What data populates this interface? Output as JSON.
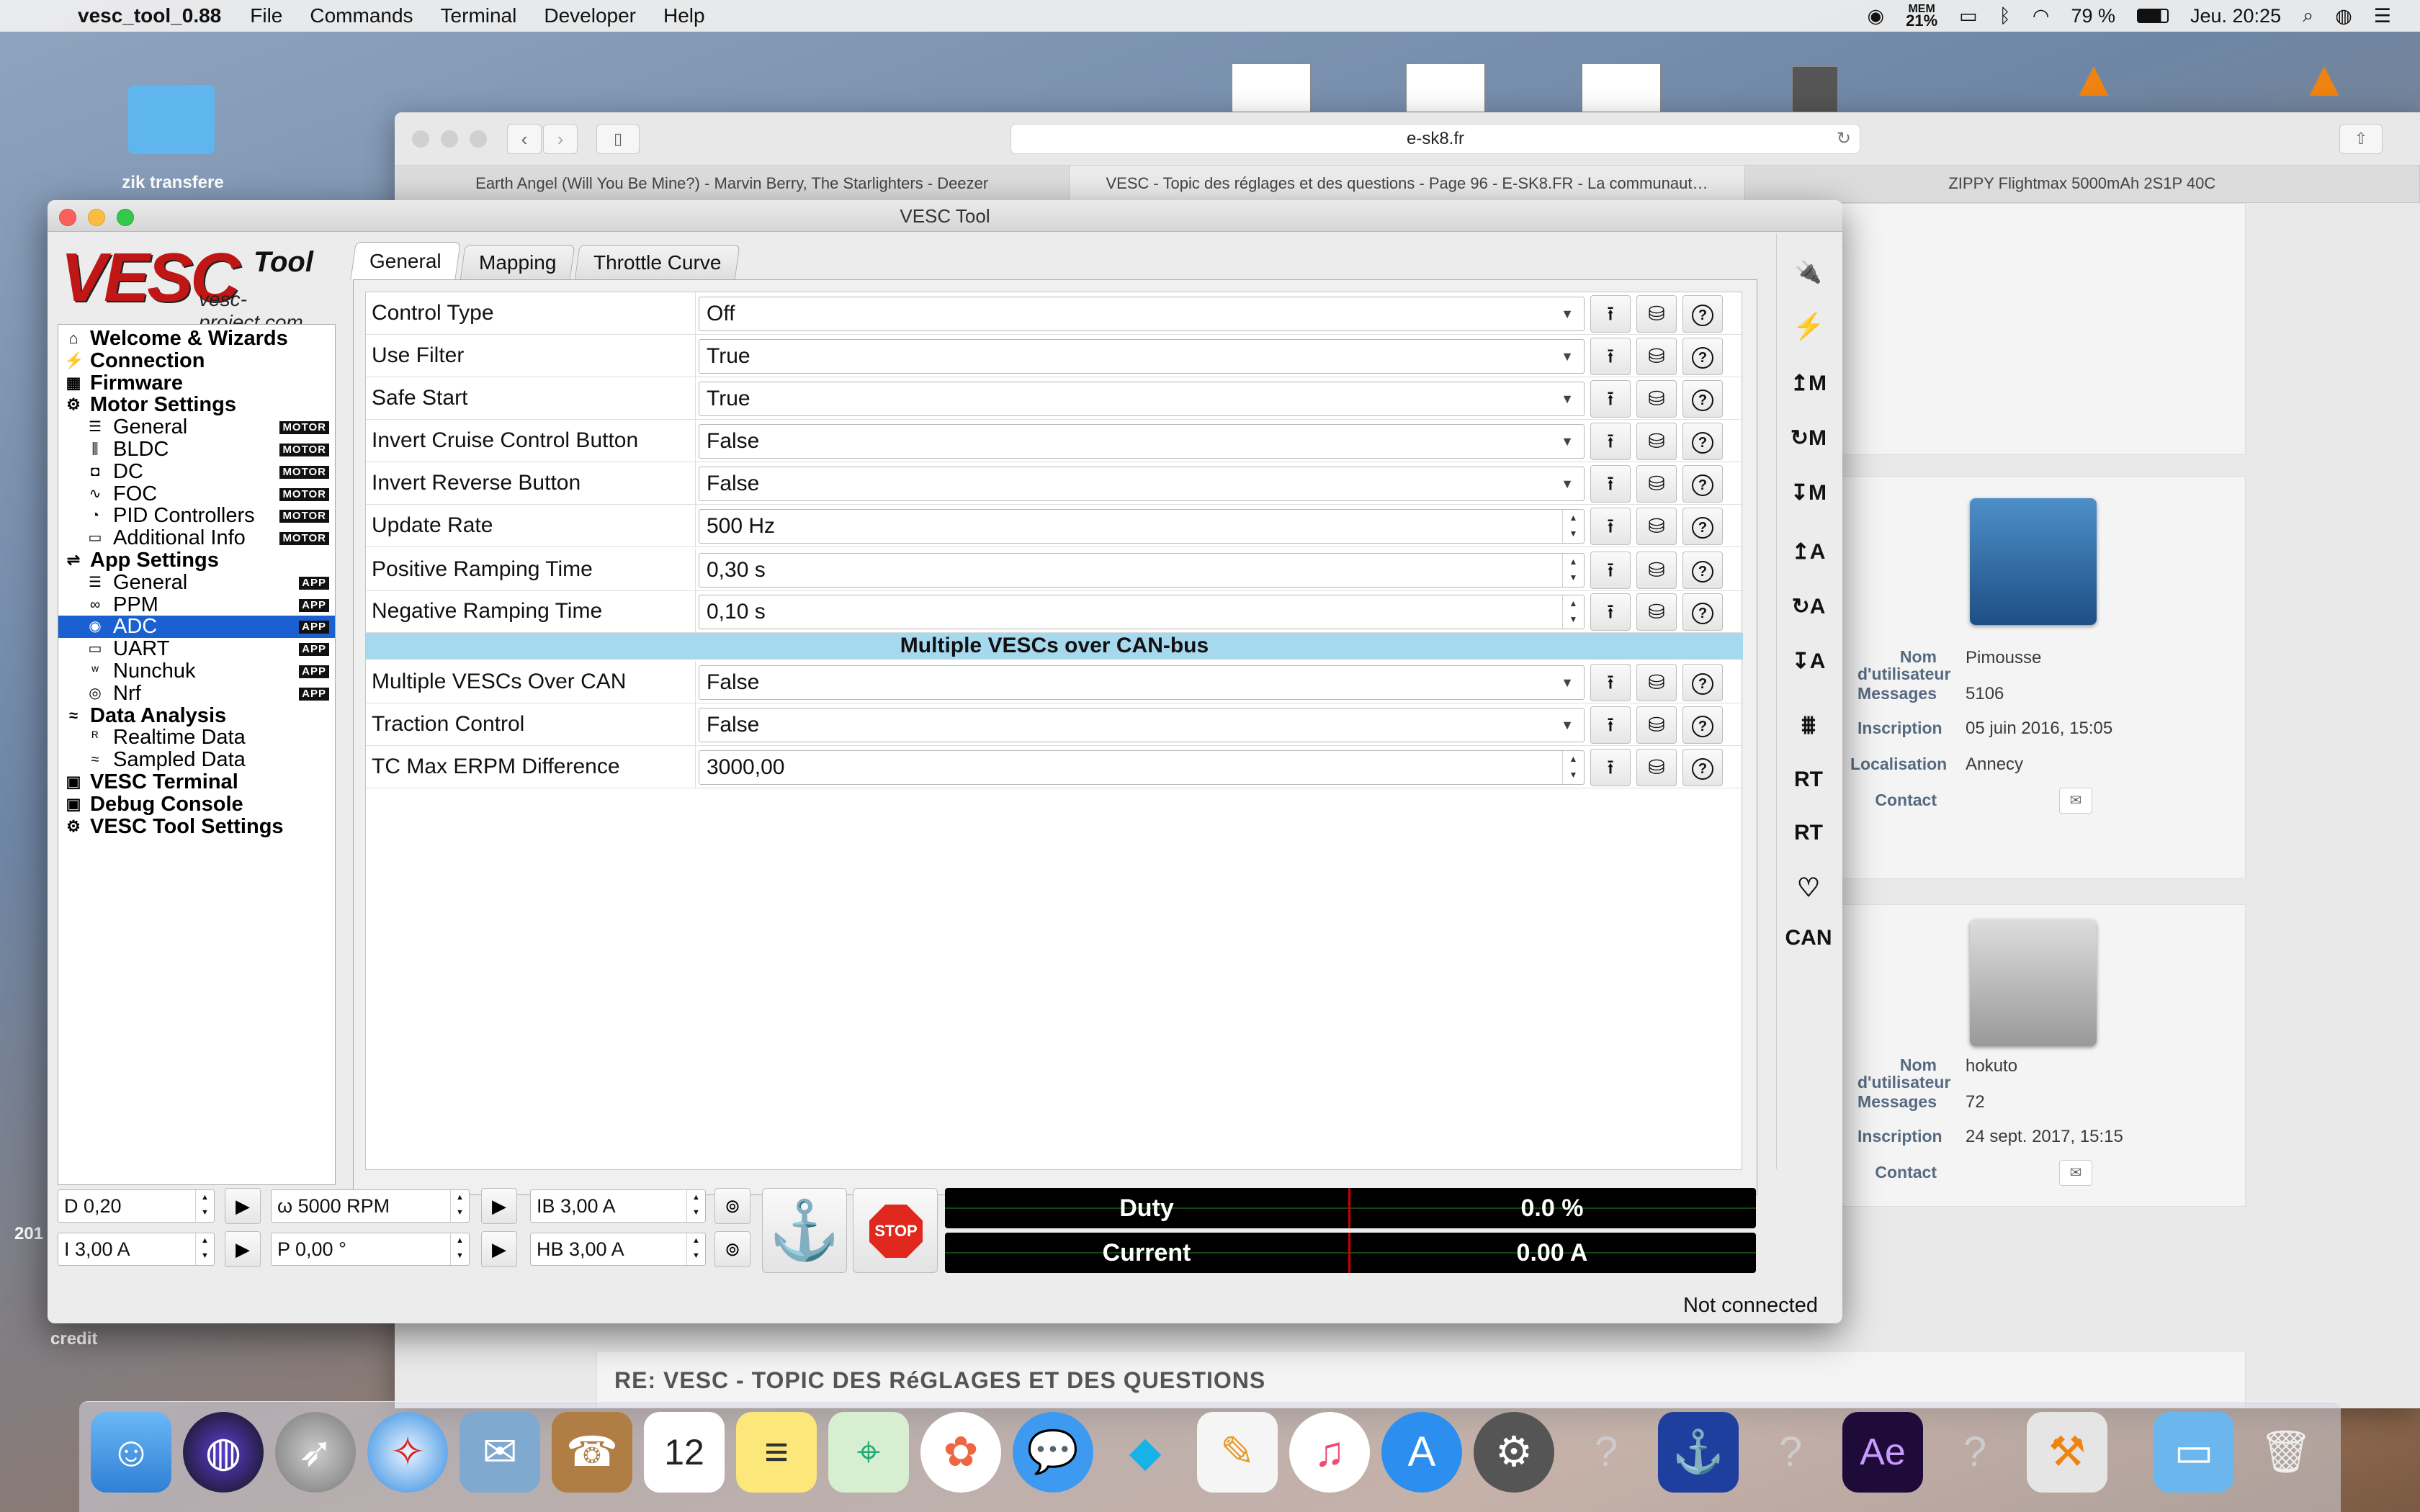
{
  "menubar": {
    "app_name": "vesc_tool_0.88",
    "items": [
      "File",
      "Commands",
      "Terminal",
      "Developer",
      "Help"
    ],
    "mem_label": "MEM",
    "mem_value": "21%",
    "battery": "79 %",
    "clock": "Jeu. 20:25"
  },
  "desktop": {
    "folder_label": "zik transfere",
    "credit_label": "credit",
    "year_fragment": "201"
  },
  "safari": {
    "url": "e-sk8.fr",
    "tabs": [
      "Earth Angel (Will You Be Mine?) - Marvin Berry, The Starlighters - Deezer",
      "VESC - Topic des réglages et des questions - Page 96 - E-SK8.FR - La communaut…",
      "ZIPPY Flightmax 5000mAh 2S1P 40C"
    ],
    "users": [
      {
        "nom_label": "Nom d'utilisateur",
        "nom": "Pimousse",
        "messages_label": "Messages",
        "messages": "5106",
        "inscription_label": "Inscription",
        "inscription": "05 juin 2016, 15:05",
        "localisation_label": "Localisation",
        "localisation": "Annecy",
        "contact_label": "Contact"
      },
      {
        "nom_label": "Nom d'utilisateur",
        "nom": "hokuto",
        "messages_label": "Messages",
        "messages": "72",
        "inscription_label": "Inscription",
        "inscription": "24 sept. 2017, 15:15",
        "contact_label": "Contact"
      }
    ],
    "post_title": "RE: VESC - TOPIC DES RéGLAGES ET DES QUESTIONS"
  },
  "vesc": {
    "title": "VESC Tool",
    "logo_text": "VESC",
    "logo_tool": "Tool",
    "logo_url": "vesc-project.com",
    "sidebar": [
      {
        "label": "Welcome & Wizards",
        "type": "top",
        "icon": "home-icon",
        "glyph": "⌂"
      },
      {
        "label": "Connection",
        "type": "top",
        "icon": "plug-icon",
        "glyph": "⚡"
      },
      {
        "label": "Firmware",
        "type": "top",
        "icon": "chip-icon",
        "glyph": "▦"
      },
      {
        "label": "Motor Settings",
        "type": "top",
        "icon": "gear-icon",
        "glyph": "⚙"
      },
      {
        "label": "General",
        "type": "sub",
        "icon": "sliders-icon",
        "glyph": "☰",
        "badge": "MOTOR"
      },
      {
        "label": "BLDC",
        "type": "sub",
        "icon": "bldc-icon",
        "glyph": "⫼",
        "badge": "MOTOR"
      },
      {
        "label": "DC",
        "type": "sub",
        "icon": "dc-motor-icon",
        "glyph": "◘",
        "badge": "MOTOR"
      },
      {
        "label": "FOC",
        "type": "sub",
        "icon": "foc-icon",
        "glyph": "∿",
        "badge": "MOTOR"
      },
      {
        "label": "PID Controllers",
        "type": "sub",
        "icon": "pid-icon",
        "glyph": "◔",
        "badge": "MOTOR"
      },
      {
        "label": "Additional Info",
        "type": "sub",
        "icon": "info-icon",
        "glyph": "▭",
        "badge": "MOTOR"
      },
      {
        "label": "App Settings",
        "type": "top",
        "icon": "app-sliders-icon",
        "glyph": "⇌"
      },
      {
        "label": "General",
        "type": "sub",
        "icon": "sliders-icon",
        "glyph": "☰",
        "badge": "APP"
      },
      {
        "label": "PPM",
        "type": "sub",
        "icon": "ppm-icon",
        "glyph": "∞",
        "badge": "APP"
      },
      {
        "label": "ADC",
        "type": "sub",
        "icon": "adc-icon",
        "glyph": "◉",
        "badge": "APP",
        "selected": true
      },
      {
        "label": "UART",
        "type": "sub",
        "icon": "uart-icon",
        "glyph": "▭",
        "badge": "APP"
      },
      {
        "label": "Nunchuk",
        "type": "sub",
        "icon": "nunchuk-icon",
        "glyph": "ʷ",
        "badge": "APP"
      },
      {
        "label": "Nrf",
        "type": "sub",
        "icon": "nrf-icon",
        "glyph": "◎",
        "badge": "APP"
      },
      {
        "label": "Data Analysis",
        "type": "top",
        "icon": "graph-icon",
        "glyph": "≈"
      },
      {
        "label": "Realtime Data",
        "type": "sub",
        "icon": "realtime-icon",
        "glyph": "ᴿ"
      },
      {
        "label": "Sampled Data",
        "type": "sub",
        "icon": "sampled-icon",
        "glyph": "≈"
      },
      {
        "label": "VESC Terminal",
        "type": "top",
        "icon": "terminal-icon",
        "glyph": "▣"
      },
      {
        "label": "Debug Console",
        "type": "top",
        "icon": "console-icon",
        "glyph": "▣"
      },
      {
        "label": "VESC Tool Settings",
        "type": "top",
        "icon": "settings-icon",
        "glyph": "⚙"
      }
    ],
    "tabs": [
      "General",
      "Mapping",
      "Throttle Curve"
    ],
    "params_a": [
      {
        "label": "Control Type",
        "value": "Off",
        "kind": "combo"
      },
      {
        "label": "Use Filter",
        "value": "True",
        "kind": "combo"
      },
      {
        "label": "Safe Start",
        "value": "True",
        "kind": "combo"
      },
      {
        "label": "Invert Cruise Control Button",
        "value": "False",
        "kind": "combo"
      },
      {
        "label": "Invert Reverse Button",
        "value": "False",
        "kind": "combo"
      },
      {
        "label": "Update Rate",
        "value": "500 Hz",
        "kind": "spin"
      },
      {
        "label": "Positive Ramping Time",
        "value": "0,30 s",
        "kind": "spin"
      },
      {
        "label": "Negative Ramping Time",
        "value": "0,10 s",
        "kind": "spin"
      }
    ],
    "section_title": "Multiple VESCs over CAN-bus",
    "params_b": [
      {
        "label": "Multiple VESCs Over CAN",
        "value": "False",
        "kind": "combo"
      },
      {
        "label": "Traction Control",
        "value": "False",
        "kind": "combo"
      },
      {
        "label": "TC Max ERPM Difference",
        "value": "3000,00",
        "kind": "spin"
      }
    ],
    "right_toolbar": [
      {
        "name": "connect-icon",
        "glyph": "🔌"
      },
      {
        "name": "disconnect-icon",
        "glyph": "⚡"
      },
      {
        "name": "read-motor-config-icon",
        "glyph": "↥M"
      },
      {
        "name": "read-default-motor-config-icon",
        "glyph": "↻M"
      },
      {
        "name": "write-motor-config-icon",
        "glyph": "↧M"
      },
      {
        "name": "read-app-config-icon",
        "glyph": "↥A"
      },
      {
        "name": "read-default-app-config-icon",
        "glyph": "↻A"
      },
      {
        "name": "write-app-config-icon",
        "glyph": "↧A"
      },
      {
        "name": "detect-icon",
        "glyph": "⩩"
      },
      {
        "name": "rt-data-icon",
        "glyph": "RT"
      },
      {
        "name": "rt-app-icon",
        "glyph": "RT"
      },
      {
        "name": "heartbeat-icon",
        "glyph": "♡"
      },
      {
        "name": "can-fwd-icon",
        "glyph": "CAN"
      }
    ],
    "bottom": {
      "duty": "D 0,20",
      "current": "I 3,00 A",
      "speed": "ω 5000 RPM",
      "position": "P 0,00 °",
      "brake": "IB 3,00 A",
      "handbrake": "HB 3,00 A",
      "gauge_duty_label": "Duty",
      "gauge_duty_value": "0.0 %",
      "gauge_current_label": "Current",
      "gauge_current_value": "0.00 A",
      "stop_label": "STOP",
      "status": "Not connected"
    }
  }
}
